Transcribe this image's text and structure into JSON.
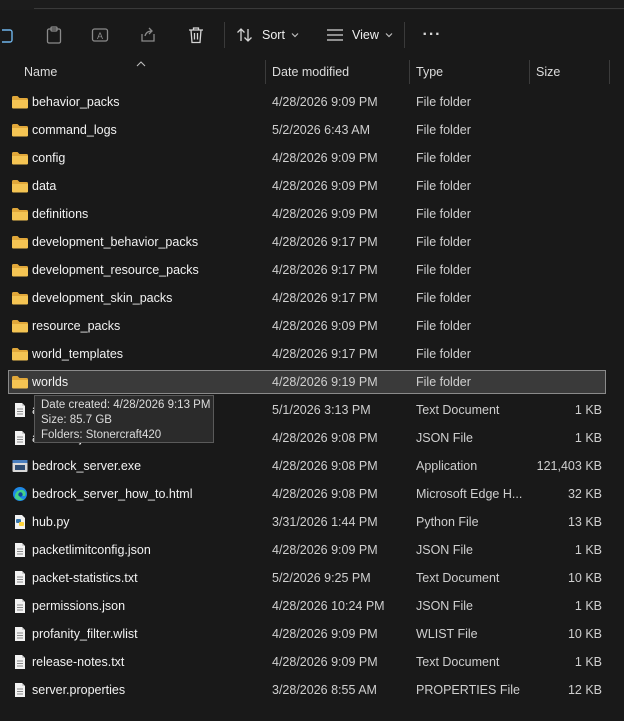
{
  "toolbar": {
    "sort_label": "Sort",
    "view_label": "View",
    "more_label": "···"
  },
  "columns": {
    "name": "Name",
    "date": "Date modified",
    "type": "Type",
    "size": "Size"
  },
  "files": [
    {
      "name": "behavior_packs",
      "date": "4/28/2026 9:09 PM",
      "type": "File folder",
      "size": "",
      "icon": "folder-icon"
    },
    {
      "name": "command_logs",
      "date": "5/2/2026 6:43 AM",
      "type": "File folder",
      "size": "",
      "icon": "folder-icon"
    },
    {
      "name": "config",
      "date": "4/28/2026 9:09 PM",
      "type": "File folder",
      "size": "",
      "icon": "folder-icon"
    },
    {
      "name": "data",
      "date": "4/28/2026 9:09 PM",
      "type": "File folder",
      "size": "",
      "icon": "folder-icon"
    },
    {
      "name": "definitions",
      "date": "4/28/2026 9:09 PM",
      "type": "File folder",
      "size": "",
      "icon": "folder-icon"
    },
    {
      "name": "development_behavior_packs",
      "date": "4/28/2026 9:17 PM",
      "type": "File folder",
      "size": "",
      "icon": "folder-icon"
    },
    {
      "name": "development_resource_packs",
      "date": "4/28/2026 9:17 PM",
      "type": "File folder",
      "size": "",
      "icon": "folder-icon"
    },
    {
      "name": "development_skin_packs",
      "date": "4/28/2026 9:17 PM",
      "type": "File folder",
      "size": "",
      "icon": "folder-icon"
    },
    {
      "name": "resource_packs",
      "date": "4/28/2026 9:09 PM",
      "type": "File folder",
      "size": "",
      "icon": "folder-icon"
    },
    {
      "name": "world_templates",
      "date": "4/28/2026 9:17 PM",
      "type": "File folder",
      "size": "",
      "icon": "folder-icon"
    },
    {
      "name": "worlds",
      "date": "4/28/2026 9:19 PM",
      "type": "File folder",
      "size": "",
      "icon": "folder-icon",
      "selected": true
    },
    {
      "name": "allowlist.json",
      "date": "5/1/2026 3:13 PM",
      "type": "Text Document",
      "size": "1 KB",
      "icon": "document-icon"
    },
    {
      "name": "allowlist.json",
      "date": "4/28/2026 9:08 PM",
      "type": "JSON File",
      "size": "1 KB",
      "icon": "document-icon"
    },
    {
      "name": "bedrock_server.exe",
      "date": "4/28/2026 9:08 PM",
      "type": "Application",
      "size": "121,403 KB",
      "icon": "application-icon"
    },
    {
      "name": "bedrock_server_how_to.html",
      "date": "4/28/2026 9:08 PM",
      "type": "Microsoft Edge H...",
      "size": "32 KB",
      "icon": "edge-icon"
    },
    {
      "name": "hub.py",
      "date": "3/31/2026 1:44 PM",
      "type": "Python File",
      "size": "13 KB",
      "icon": "python-icon"
    },
    {
      "name": "packetlimitconfig.json",
      "date": "4/28/2026 9:09 PM",
      "type": "JSON File",
      "size": "1 KB",
      "icon": "document-icon"
    },
    {
      "name": "packet-statistics.txt",
      "date": "5/2/2026 9:25 PM",
      "type": "Text Document",
      "size": "10 KB",
      "icon": "document-icon"
    },
    {
      "name": "permissions.json",
      "date": "4/28/2026 10:24 PM",
      "type": "JSON File",
      "size": "1 KB",
      "icon": "document-icon"
    },
    {
      "name": "profanity_filter.wlist",
      "date": "4/28/2026 9:09 PM",
      "type": "WLIST File",
      "size": "10 KB",
      "icon": "document-icon"
    },
    {
      "name": "release-notes.txt",
      "date": "4/28/2026 9:09 PM",
      "type": "Text Document",
      "size": "1 KB",
      "icon": "document-icon"
    },
    {
      "name": "server.properties",
      "date": "3/28/2026 8:55 AM",
      "type": "PROPERTIES File",
      "size": "12 KB",
      "icon": "document-icon"
    }
  ],
  "tooltip": {
    "line1": "Date created: 4/28/2026 9:13 PM",
    "line2": "Size: 85.7 GB",
    "line3": "Folders: Stonercraft420"
  },
  "colors": {
    "folder": "#f0c24b",
    "background": "#191919",
    "selected_row": "#3a3a3a"
  }
}
